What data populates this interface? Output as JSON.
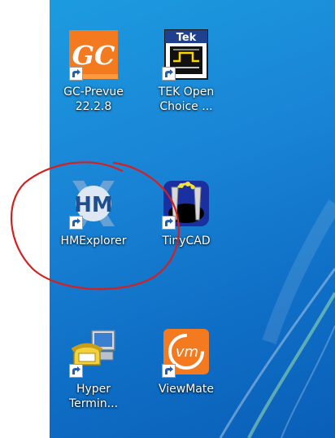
{
  "desktop": {
    "icons": [
      {
        "label_line1": "GC-Prevue",
        "label_line2": "22.2.8",
        "icon": "gc-prevue-icon",
        "glyph": "GC",
        "color": "#f47a20"
      },
      {
        "label_line1": "TEK Open",
        "label_line2": "Choice ...",
        "icon": "tek-open-choice-icon",
        "glyph": "Tek",
        "color": "#1f3f8f"
      },
      {
        "label_line1": "HMExplorer",
        "label_line2": "",
        "icon": "hmexplorer-icon",
        "glyph": "HM",
        "color": "#1f4f8f"
      },
      {
        "label_line1": "TinyCAD",
        "label_line2": "",
        "icon": "tinycad-icon",
        "color": "#1a2fa0"
      },
      {
        "label_line1": "Hyper",
        "label_line2": "Termin...",
        "icon": "hyperterminal-icon",
        "color": "#f2d13a"
      },
      {
        "label_line1": "ViewMate",
        "label_line2": "",
        "icon": "viewmate-icon",
        "glyph": "vm",
        "color": "#f47a20"
      }
    ]
  },
  "annotation": {
    "shape": "hand-drawn-circle",
    "color": "#d42020",
    "target": "HMExplorer"
  }
}
